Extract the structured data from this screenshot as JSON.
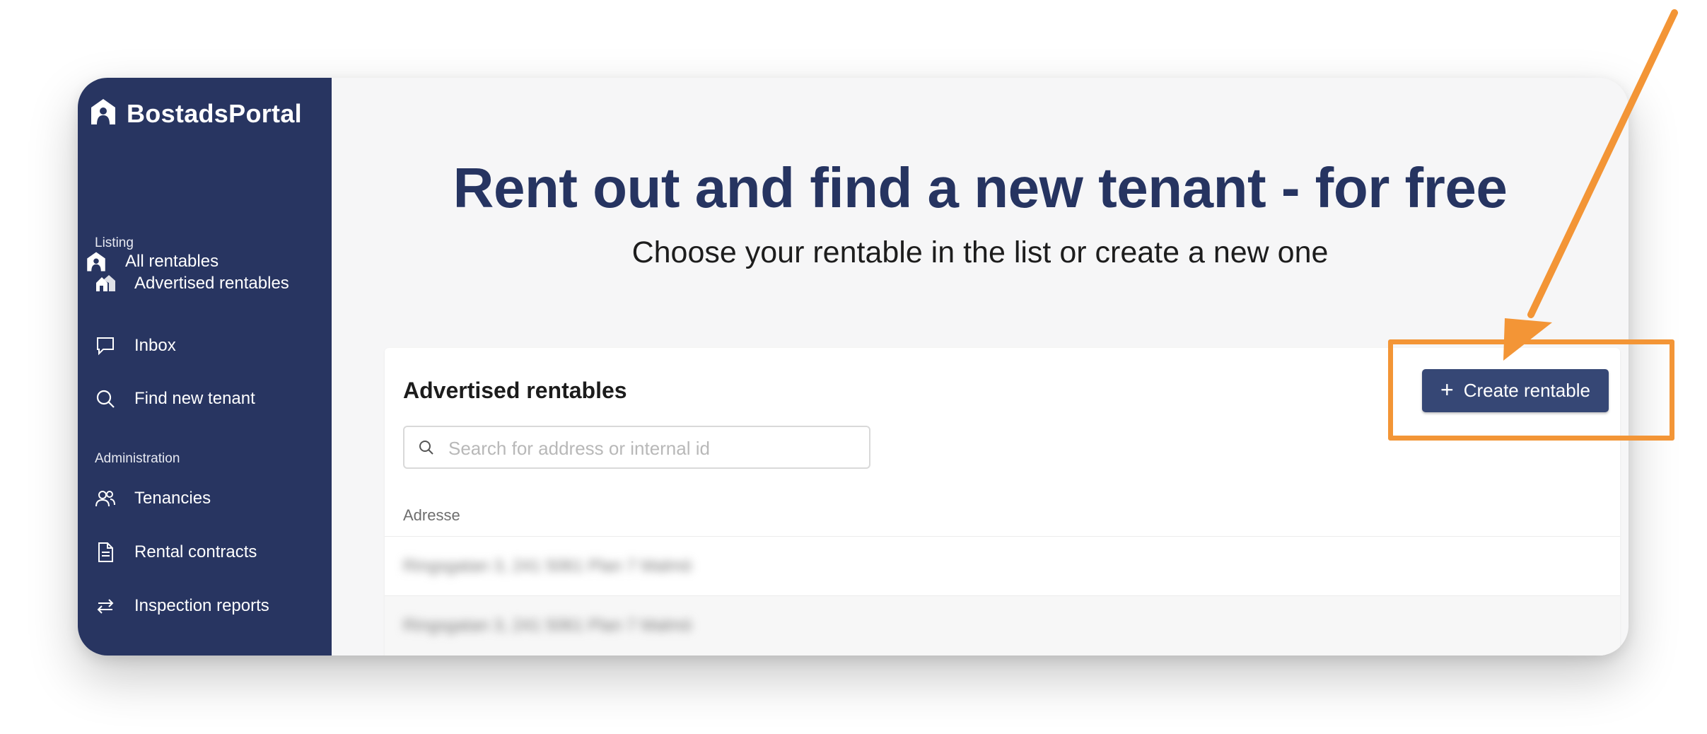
{
  "colors": {
    "sidebar_bg": "#283561",
    "hero_title": "#263461",
    "button_bg": "#364775",
    "annotation": "#f39536",
    "main_bg": "#f6f6f7"
  },
  "logo": {
    "text": "BostadsPortal",
    "icon": "home-person-icon"
  },
  "sidebar": {
    "top_item": {
      "label": "All rentables",
      "icon": "home-person-icon"
    },
    "sections": [
      {
        "label": "Listing",
        "items": [
          {
            "label": "Advertised rentables",
            "icon": "houses-icon"
          },
          {
            "label": "Inbox",
            "icon": "chat-bubble-icon"
          },
          {
            "label": "Find new tenant",
            "icon": "search-icon"
          }
        ]
      },
      {
        "label": "Administration",
        "items": [
          {
            "label": "Tenancies",
            "icon": "people-icon"
          },
          {
            "label": "Rental contracts",
            "icon": "document-icon"
          },
          {
            "label": "Inspection reports",
            "icon": "arrows-swap-icon"
          }
        ]
      }
    ]
  },
  "hero": {
    "title": "Rent out and find a new tenant - for free",
    "subtitle": "Choose your rentable in the list or create a new one"
  },
  "card": {
    "title": "Advertised rentables",
    "create_button": {
      "label": "Create rentable",
      "icon": "plus-icon"
    },
    "search": {
      "placeholder": "Search for address or internal id",
      "value": ""
    },
    "columns": [
      "Adresse"
    ],
    "rows": [
      {
        "address": "Ringsgatan 3, 241 5061 Plan 7 Malmö"
      },
      {
        "address": "Ringsgatan 3, 241 5061 Plan 7 Malmö"
      }
    ]
  },
  "annotation": {
    "type": "arrow-and-box",
    "target": "create-button"
  }
}
